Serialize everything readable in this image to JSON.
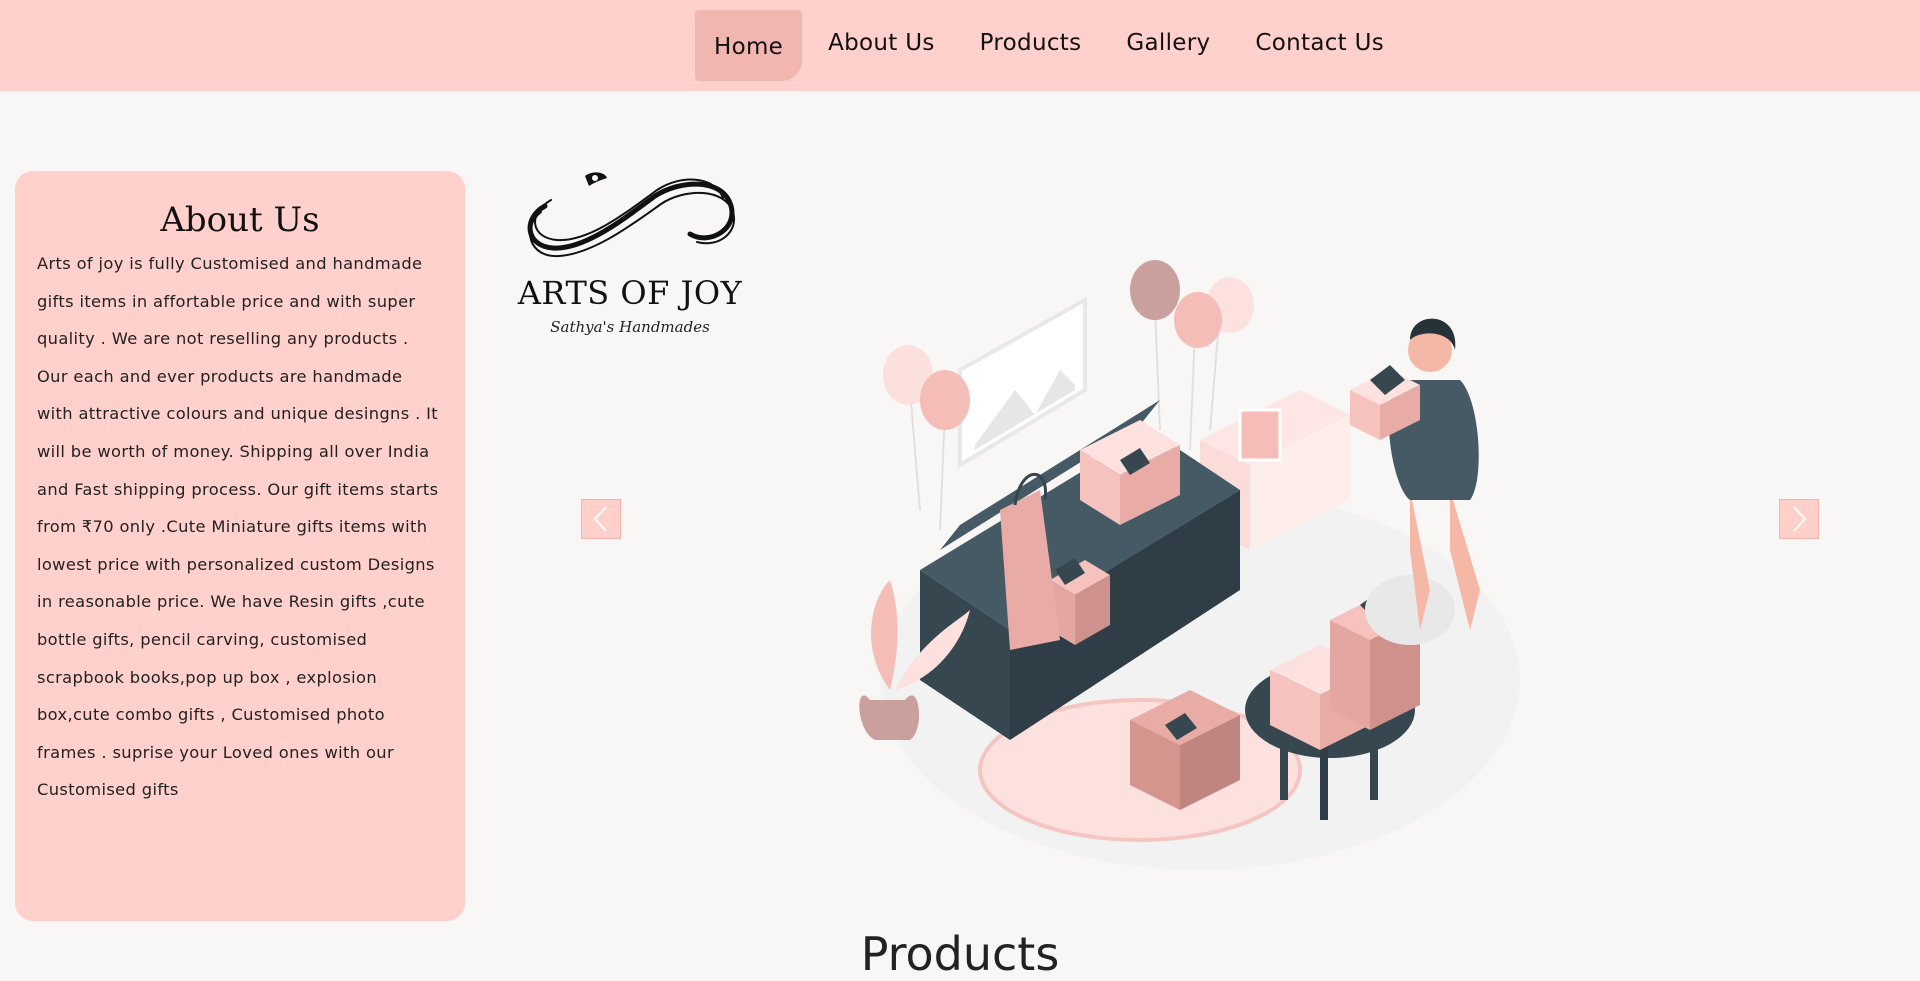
{
  "nav": {
    "items": [
      {
        "label": "Home",
        "active": true
      },
      {
        "label": "About Us",
        "active": false
      },
      {
        "label": "Products",
        "active": false
      },
      {
        "label": "Gallery",
        "active": false
      },
      {
        "label": "Contact Us",
        "active": false
      }
    ]
  },
  "about": {
    "title": "About Us",
    "text": "Arts of joy is fully Customised and handmade gifts items in affortable price and with super quality . We are not reselling any products . Our each and ever products are handmade with attractive colours and unique desingns . It will be worth of money. Shipping all over India and Fast shipping process. Our gift items starts from ₹70 only .Cute Miniature gifts items with lowest price with personalized custom Designs in reasonable price. We have Resin gifts ,cute bottle gifts, pencil carving, customised scrapbook books,pop up box , explosion box,cute combo gifts , Customised photo frames . suprise your Loved ones with our Customised gifts"
  },
  "logo": {
    "brand": "ARTS OF JOY",
    "subtitle": "Sathya's Handmades"
  },
  "carousel": {
    "prev_icon": "chevron-left-icon",
    "next_icon": "chevron-right-icon"
  },
  "products": {
    "heading": "Products"
  },
  "colors": {
    "nav_bg": "#ffd0cc",
    "nav_active": "#f2b6b0",
    "page_bg": "#f9f7f6",
    "card_bg": "#ffd0cc",
    "illustration_dark": "#37474f",
    "illustration_pink": "#f5c2bd"
  }
}
